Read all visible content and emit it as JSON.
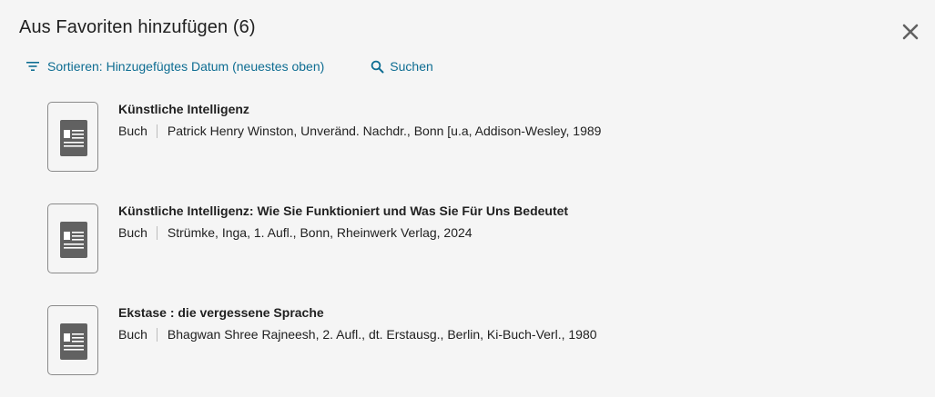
{
  "dialog": {
    "title": "Aus Favoriten hinzufügen (6)"
  },
  "toolbar": {
    "sort_label": "Sortieren: Hinzugefügtes Datum (neuestes oben)",
    "search_label": "Suchen"
  },
  "colors": {
    "accent": "#0e6d92",
    "background": "#f5f5f5",
    "text": "#212121",
    "icon_gray": "#616161"
  },
  "items": [
    {
      "title": "Künstliche Intelligenz",
      "type": "Buch",
      "details": "Patrick Henry Winston, Unveränd. Nachdr., Bonn [u.a, Addison-Wesley, 1989",
      "icon": "document-icon"
    },
    {
      "title": "Künstliche Intelligenz: Wie Sie Funktioniert und Was Sie Für Uns Bedeutet",
      "type": "Buch",
      "details": "Strümke, Inga, 1. Aufl., Bonn, Rheinwerk Verlag, 2024",
      "icon": "document-icon"
    },
    {
      "title": "Ekstase : die vergessene Sprache",
      "type": "Buch",
      "details": "Bhagwan Shree Rajneesh, 2. Aufl., dt. Erstausg., Berlin, Ki-Buch-Verl., 1980",
      "icon": "document-icon"
    }
  ]
}
